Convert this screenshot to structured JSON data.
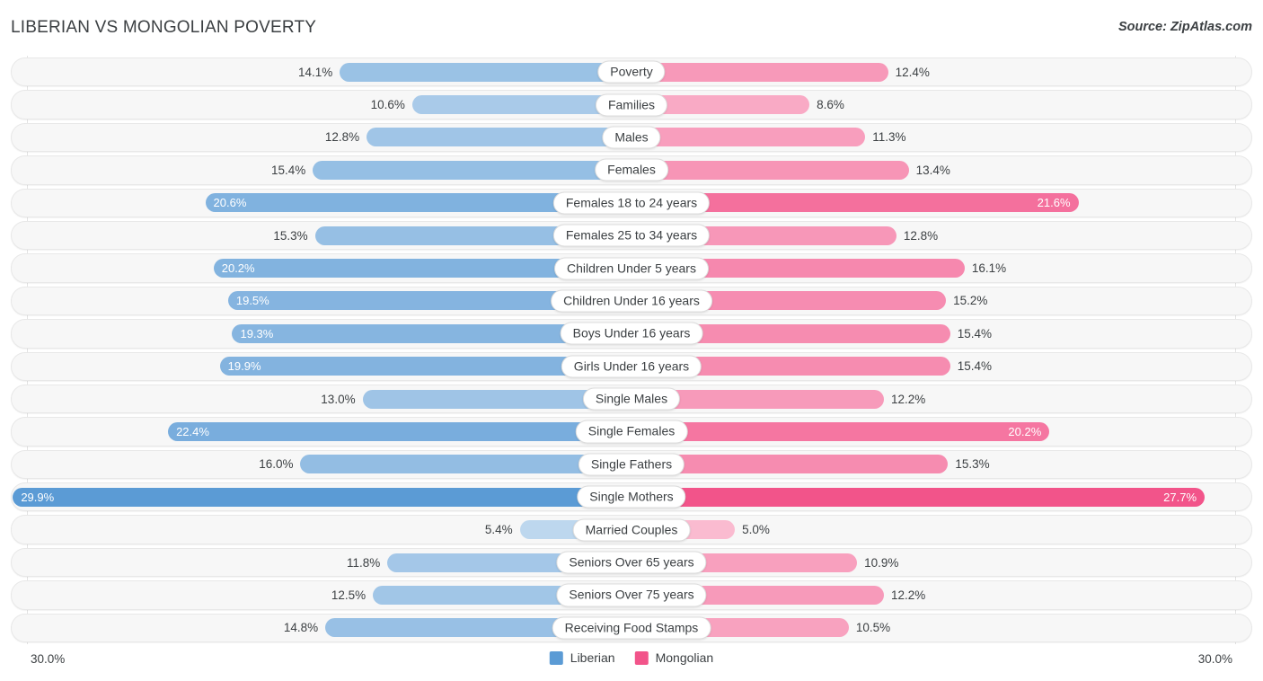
{
  "header": {
    "title": "LIBERIAN VS MONGOLIAN POVERTY",
    "source": "Source: ZipAtlas.com"
  },
  "footer": {
    "axis_min_label": "30.0%",
    "axis_max_label": "30.0%"
  },
  "legend": {
    "items": [
      {
        "label": "Liberian",
        "color": "#5b9bd5"
      },
      {
        "label": "Mongolian",
        "color": "#f2548a"
      }
    ]
  },
  "chart_data": {
    "type": "bar",
    "subtype": "diverging-horizontal",
    "title": "LIBERIAN VS MONGOLIAN POVERTY",
    "xlabel": "",
    "ylabel": "",
    "xlim": [
      30.0,
      30.0
    ],
    "axis_max": 30.0,
    "unit": "%",
    "grid": true,
    "legend_position": "bottom-center",
    "categories": [
      "Poverty",
      "Families",
      "Males",
      "Females",
      "Females 18 to 24 years",
      "Females 25 to 34 years",
      "Children Under 5 years",
      "Children Under 16 years",
      "Boys Under 16 years",
      "Girls Under 16 years",
      "Single Males",
      "Single Females",
      "Single Fathers",
      "Single Mothers",
      "Married Couples",
      "Seniors Over 65 years",
      "Seniors Over 75 years",
      "Receiving Food Stamps"
    ],
    "series": [
      {
        "name": "Liberian",
        "color": "#5b9bd5",
        "side": "left",
        "values": [
          14.1,
          10.6,
          12.8,
          15.4,
          20.6,
          15.3,
          20.2,
          19.5,
          19.3,
          19.9,
          13.0,
          22.4,
          16.0,
          29.9,
          5.4,
          11.8,
          12.5,
          14.8
        ]
      },
      {
        "name": "Mongolian",
        "color": "#f2548a",
        "side": "right",
        "values": [
          12.4,
          8.6,
          11.3,
          13.4,
          21.6,
          12.8,
          16.1,
          15.2,
          15.4,
          15.4,
          12.2,
          20.2,
          15.3,
          27.7,
          5.0,
          10.9,
          12.2,
          10.5
        ]
      }
    ]
  },
  "rows": [
    {
      "label": "Poverty",
      "left_value": "14.1%",
      "right_value": "12.4%",
      "left_num": 14.1,
      "right_num": 12.4
    },
    {
      "label": "Families",
      "left_value": "10.6%",
      "right_value": "8.6%",
      "left_num": 10.6,
      "right_num": 8.6
    },
    {
      "label": "Males",
      "left_value": "12.8%",
      "right_value": "11.3%",
      "left_num": 12.8,
      "right_num": 11.3
    },
    {
      "label": "Females",
      "left_value": "15.4%",
      "right_value": "13.4%",
      "left_num": 15.4,
      "right_num": 13.4
    },
    {
      "label": "Females 18 to 24 years",
      "left_value": "20.6%",
      "right_value": "21.6%",
      "left_num": 20.6,
      "right_num": 21.6
    },
    {
      "label": "Females 25 to 34 years",
      "left_value": "15.3%",
      "right_value": "12.8%",
      "left_num": 15.3,
      "right_num": 12.8
    },
    {
      "label": "Children Under 5 years",
      "left_value": "20.2%",
      "right_value": "16.1%",
      "left_num": 20.2,
      "right_num": 16.1
    },
    {
      "label": "Children Under 16 years",
      "left_value": "19.5%",
      "right_value": "15.2%",
      "left_num": 19.5,
      "right_num": 15.2
    },
    {
      "label": "Boys Under 16 years",
      "left_value": "19.3%",
      "right_value": "15.4%",
      "left_num": 19.3,
      "right_num": 15.4
    },
    {
      "label": "Girls Under 16 years",
      "left_value": "19.9%",
      "right_value": "15.4%",
      "left_num": 19.9,
      "right_num": 15.4
    },
    {
      "label": "Single Males",
      "left_value": "13.0%",
      "right_value": "12.2%",
      "left_num": 13.0,
      "right_num": 12.2
    },
    {
      "label": "Single Females",
      "left_value": "22.4%",
      "right_value": "20.2%",
      "left_num": 22.4,
      "right_num": 20.2
    },
    {
      "label": "Single Fathers",
      "left_value": "16.0%",
      "right_value": "15.3%",
      "left_num": 16.0,
      "right_num": 15.3
    },
    {
      "label": "Single Mothers",
      "left_value": "29.9%",
      "right_value": "27.7%",
      "left_num": 29.9,
      "right_num": 27.7
    },
    {
      "label": "Married Couples",
      "left_value": "5.4%",
      "right_value": "5.0%",
      "left_num": 5.4,
      "right_num": 5.0
    },
    {
      "label": "Seniors Over 65 years",
      "left_value": "11.8%",
      "right_value": "10.9%",
      "left_num": 11.8,
      "right_num": 10.9
    },
    {
      "label": "Seniors Over 75 years",
      "left_value": "12.5%",
      "right_value": "12.2%",
      "left_num": 12.5,
      "right_num": 12.2
    },
    {
      "label": "Receiving Food Stamps",
      "left_value": "14.8%",
      "right_value": "10.5%",
      "left_num": 14.8,
      "right_num": 10.5
    }
  ]
}
